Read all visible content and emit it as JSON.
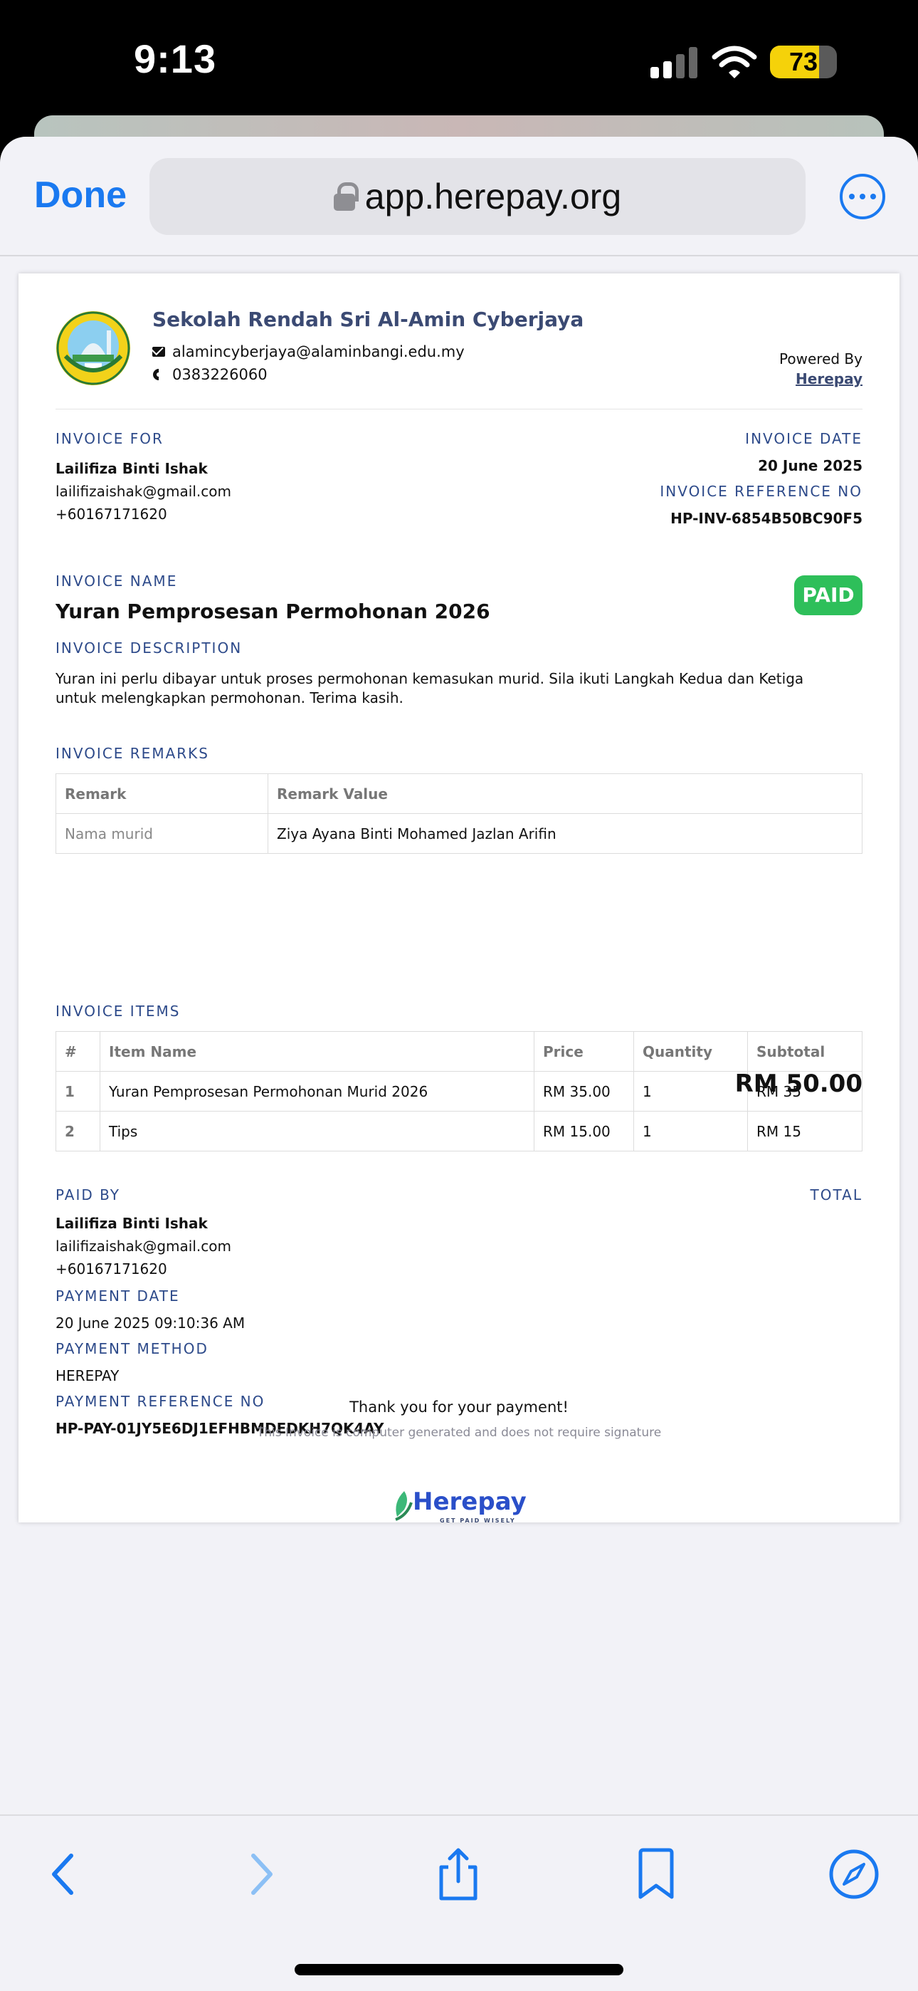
{
  "status_bar": {
    "time": "9:13",
    "battery": "73",
    "battery_level": 0.73
  },
  "browser": {
    "done_label": "Done",
    "url": "app.herepay.org"
  },
  "school": {
    "name": "Sekolah Rendah Sri Al-Amin Cyberjaya",
    "email": "alamincyberjaya@alaminbangi.edu.my",
    "phone": "0383226060"
  },
  "powered": {
    "label": "Powered By",
    "link": "Herepay"
  },
  "invoice_for": {
    "label": "INVOICE FOR",
    "name": "Lailifiza Binti Ishak",
    "email": "lailifizaishak@gmail.com",
    "phone": "+60167171620"
  },
  "invoice_date": {
    "label": "INVOICE DATE",
    "value": "20 June 2025"
  },
  "invoice_ref": {
    "label": "INVOICE REFERENCE NO",
    "value": "HP-INV-6854B50BC90F5"
  },
  "invoice_name": {
    "label": "INVOICE NAME",
    "value": "Yuran Pemprosesan Permohonan 2026"
  },
  "status_badge": "PAID",
  "invoice_description": {
    "label": "INVOICE DESCRIPTION",
    "value": "Yuran ini perlu dibayar untuk proses permohonan kemasukan murid. Sila ikuti Langkah Kedua dan Ketiga untuk melengkapkan permohonan. Terima kasih."
  },
  "remarks": {
    "label": "INVOICE REMARKS",
    "headers": [
      "Remark",
      "Remark Value"
    ],
    "rows": [
      [
        "Nama murid",
        "Ziya Ayana Binti Mohamed Jazlan Arifin"
      ]
    ]
  },
  "items": {
    "label": "INVOICE ITEMS",
    "headers": [
      "#",
      "Item Name",
      "Price",
      "Quantity",
      "Subtotal"
    ],
    "rows": [
      [
        "1",
        "Yuran Pemprosesan Permohonan Murid 2026",
        "RM 35.00",
        "1",
        "RM 35"
      ],
      [
        "2",
        "Tips",
        "RM 15.00",
        "1",
        "RM 15"
      ]
    ]
  },
  "paid_by": {
    "label": "PAID BY",
    "name": "Lailifiza Binti Ishak",
    "email": "lailifizaishak@gmail.com",
    "phone": "+60167171620"
  },
  "total": {
    "label": "TOTAL",
    "value": "RM 50.00"
  },
  "payment_date": {
    "label": "PAYMENT DATE",
    "value": "20 June 2025 09:10:36 AM"
  },
  "payment_method": {
    "label": "PAYMENT METHOD",
    "value": "HEREPAY"
  },
  "payment_ref": {
    "label": "PAYMENT REFERENCE NO",
    "value": "HP-PAY-01JY5E6DJ1EFHBMDEDKH7QK4AY"
  },
  "footer": {
    "brand": "Herepay",
    "tagline": "GET PAID WISELY",
    "thanks": "Thank you for your payment!",
    "disclaimer": "This Invoice is computer generated and does not require signature"
  },
  "colors": {
    "accent": "#1a79f0",
    "label": "#2d4a8a",
    "paid": "#2ebf5a",
    "brand_green": "#3cb878",
    "brand_blue": "#2a4fc9"
  },
  "icons": [
    "lock-icon",
    "more-icon",
    "mail-icon",
    "phone-icon",
    "back-icon",
    "forward-icon",
    "share-icon",
    "bookmark-icon",
    "compass-icon"
  ]
}
